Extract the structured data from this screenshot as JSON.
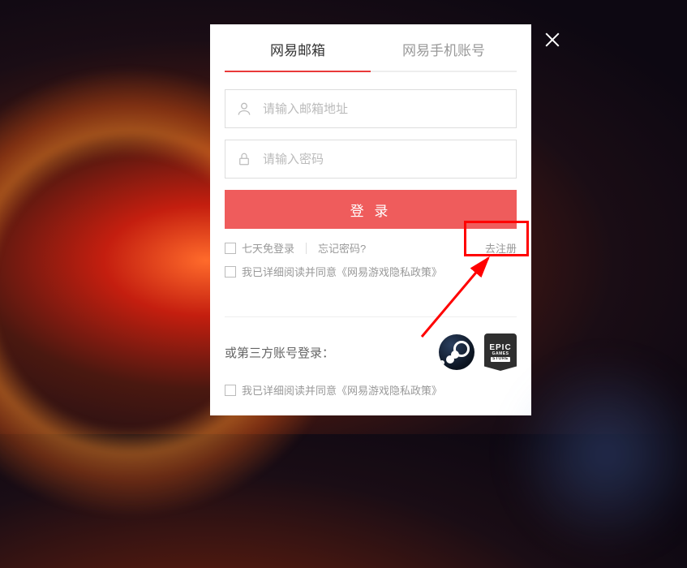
{
  "tabs": {
    "email": "网易邮箱",
    "phone": "网易手机账号"
  },
  "inputs": {
    "email_placeholder": "请输入邮箱地址",
    "password_placeholder": "请输入密码"
  },
  "buttons": {
    "login": "登 录"
  },
  "options": {
    "remember": "七天免登录",
    "forgot": "忘记密码?",
    "register": "去注册"
  },
  "agreement": {
    "prefix": "我已详细阅读并同意",
    "policy": "《网易游戏隐私政策》"
  },
  "thirdparty": {
    "label": "或第三方账号登录："
  },
  "epic": {
    "l1": "EPIC",
    "l2": "GAMES",
    "l3": "STORE"
  }
}
